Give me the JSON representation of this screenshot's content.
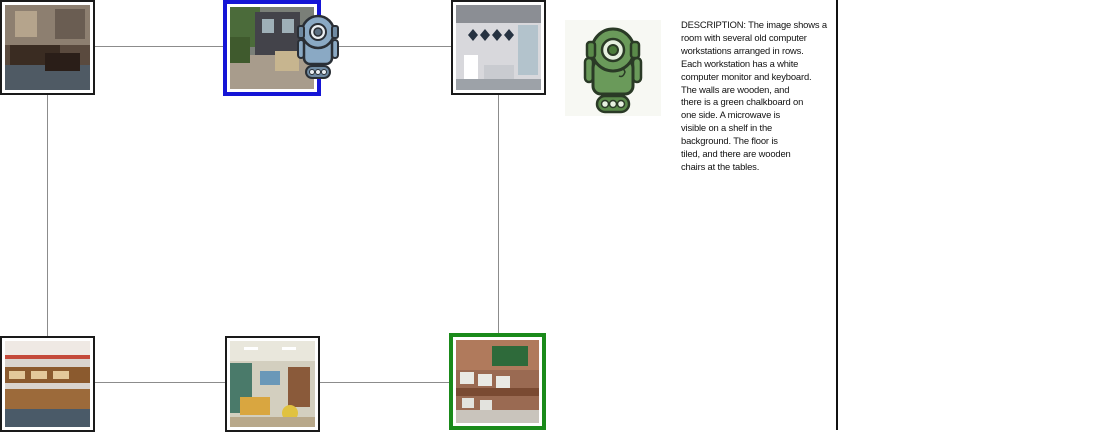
{
  "description": {
    "text": "DESCRIPTION: The image shows a\nroom with several old computer\nworkstations arranged in rows.\nEach workstation has a white\ncomputer monitor and keyboard.\nThe walls are wooden, and\nthere is a green chalkboard on\none side. A microwave is\nvisible on a shelf in the\nbackground. The floor is\ntiled, and there are wooden\nchairs at the tables."
  },
  "nodes": [
    {
      "id": "top-left",
      "scene": "living-room",
      "state": "default"
    },
    {
      "id": "top-middle",
      "scene": "house-backyard",
      "state": "current"
    },
    {
      "id": "top-right",
      "scene": "bathroom",
      "state": "default"
    },
    {
      "id": "bottom-left",
      "scene": "library",
      "state": "default"
    },
    {
      "id": "bottom-middle",
      "scene": "classroom-kids",
      "state": "default"
    },
    {
      "id": "bottom-right",
      "scene": "computer-lab",
      "state": "target"
    }
  ],
  "colors": {
    "current_border": "#1515d6",
    "target_border": "#1a8a1a",
    "edge": "#8c8c8c",
    "robot_blue": "#8aa9c4",
    "robot_green": "#6a9a5a"
  },
  "icons": {
    "marker": "robot-icon",
    "panel": "green-robot-icon"
  }
}
